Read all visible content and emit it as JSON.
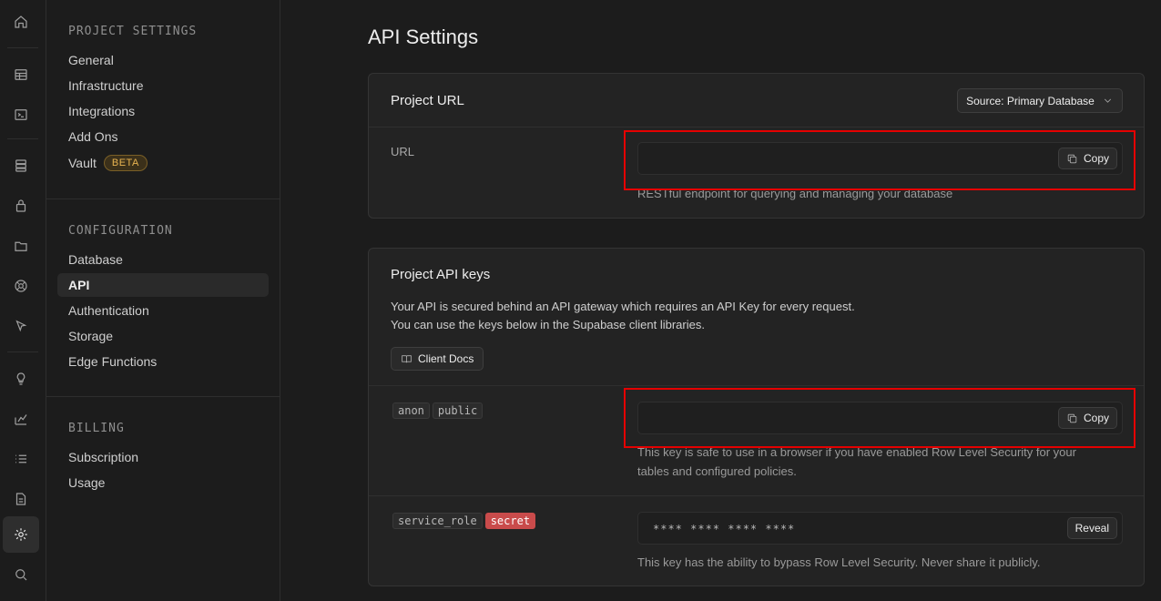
{
  "sidebar": {
    "sections": [
      {
        "title": "PROJECT SETTINGS",
        "items": [
          "General",
          "Infrastructure",
          "Integrations",
          "Add Ons",
          "Vault"
        ]
      },
      {
        "title": "CONFIGURATION",
        "items": [
          "Database",
          "API",
          "Authentication",
          "Storage",
          "Edge Functions"
        ]
      },
      {
        "title": "BILLING",
        "items": [
          "Subscription",
          "Usage"
        ]
      }
    ],
    "vault_badge": "BETA",
    "active_item": "API"
  },
  "rail": {
    "icons": [
      "home-icon",
      "table-editor-icon",
      "sql-editor-icon",
      "database-icon",
      "auth-icon",
      "storage-icon",
      "realtime-icon",
      "edge-functions-icon",
      "advisors-icon",
      "reports-icon",
      "logs-icon",
      "docs-icon",
      "settings-icon",
      "search-icon"
    ],
    "active": "settings-icon"
  },
  "page": {
    "title": "API Settings"
  },
  "project_url": {
    "title": "Project URL",
    "source_dropdown": "Source: Primary Database",
    "url_label": "URL",
    "url_value": "",
    "copy_label": "Copy",
    "help": "RESTful endpoint for querying and managing your database"
  },
  "api_keys": {
    "title": "Project API keys",
    "desc_line1": "Your API is secured behind an API gateway which requires an API Key for every request.",
    "desc_line2": "You can use the keys below in the Supabase client libraries.",
    "client_docs_label": "Client Docs",
    "anon": {
      "tags": [
        "anon",
        "public"
      ],
      "value": "",
      "copy_label": "Copy",
      "help_line1": "This key is safe to use in a browser if you have enabled Row Level Security for your",
      "help_line2": "tables and configured policies."
    },
    "service_role": {
      "tags": [
        "service_role",
        "secret"
      ],
      "masked_value": "**** **** **** ****",
      "reveal_label": "Reveal",
      "help": "This key has the ability to bypass Row Level Security. Never share it publicly."
    }
  },
  "colors": {
    "highlight_border": "#e50000",
    "secret_tag": "#c94b4b",
    "beta_badge": "#e8b451"
  }
}
